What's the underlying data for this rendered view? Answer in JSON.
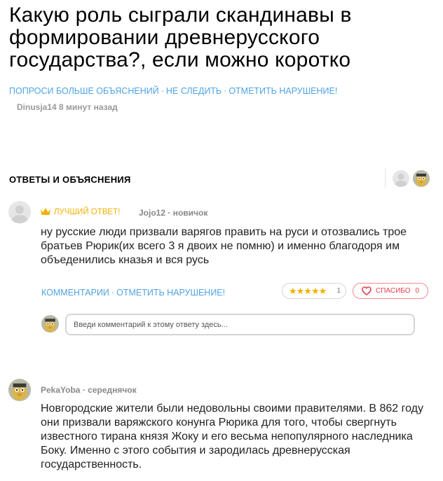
{
  "question": {
    "title": "Какую роль сыграли скандинавы в формировании древнерусского государства?, если можно коротко",
    "actions": {
      "ask_more": "ПОПРОСИ БОЛЬШЕ ОБЪЯСНЕНИЙ",
      "unfollow": "НЕ СЛЕДИТЬ",
      "report": "ОТМЕТИТЬ НАРУШЕНИЕ!",
      "separator": "·"
    },
    "author": "Dinusja14",
    "time": "8 минут назад"
  },
  "answers_section": {
    "title": "ОТВЕТЫ И ОБЪЯСНЕНИЯ"
  },
  "answers": [
    {
      "best_label": "ЛУЧШИЙ ОТВЕТ!",
      "author": "Jojo12",
      "rank": "новичок",
      "text": "ну русские люди призвали варягов править на руси и отозвались трое братьев Рюрик(их всего 3 я двоих не помню) и именно благодоря им объеденились кназья и вся русь",
      "actions": {
        "comments": "КОММЕНТАРИИ",
        "report": "ОТМЕТИТЬ НАРУШЕНИЕ!",
        "separator": "·"
      },
      "rating": {
        "stars": "★★★★★",
        "count": "1"
      },
      "thanks": {
        "label": "СПАСИБО",
        "count": "0"
      },
      "comment_placeholder": "Введи комментарий к этому ответу здесь..."
    },
    {
      "author": "PekaYoba",
      "rank": "середнячок",
      "text": "Новгородские жители были недовольны своими правителями. В 862 году они призвали варяжского конунга Рюрика для того, чтобы свергнуть известного тирана князя Жоку и его весьма непопулярного наследника Боку. Именно с этого события и зародилась древнерусская государственность."
    }
  ],
  "colors": {
    "link": "#4fa3e2",
    "gold": "#f4b000",
    "thanks": "#e2414d",
    "meta": "#9a9a9a"
  },
  "icons": {
    "default_avatar": "person-silhouette",
    "user_avatar": "bird-character",
    "crown": "crown-icon",
    "heart": "heart-icon"
  }
}
